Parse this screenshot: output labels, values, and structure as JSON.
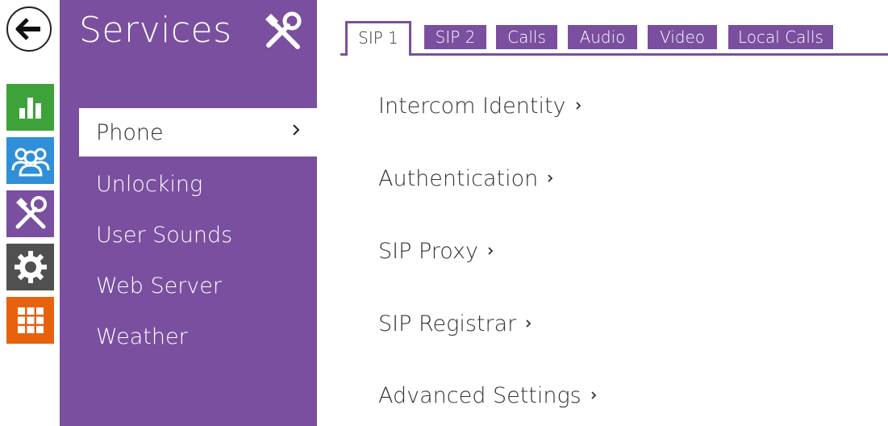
{
  "colors": {
    "accent": "#7a4f9f",
    "green": "#3ea23a",
    "blue": "#2f8fd8",
    "purple": "#7a4f9f",
    "gray": "#505050",
    "orange": "#e7620e"
  },
  "rail": {
    "back_icon": "arrow-left-icon",
    "tiles": [
      {
        "icon": "bar-chart-icon",
        "color": "#3ea23a"
      },
      {
        "icon": "users-icon",
        "color": "#2f8fd8"
      },
      {
        "icon": "tools-icon",
        "color": "#7a4f9f"
      },
      {
        "icon": "gear-icon",
        "color": "#505050"
      },
      {
        "icon": "grid-icon",
        "color": "#e7620e"
      }
    ]
  },
  "sidebar": {
    "title": "Services",
    "title_icon": "tools-icon",
    "items": [
      {
        "label": "Phone",
        "active": true
      },
      {
        "label": "Unlocking",
        "active": false
      },
      {
        "label": "User Sounds",
        "active": false
      },
      {
        "label": "Web Server",
        "active": false
      },
      {
        "label": "Weather",
        "active": false
      }
    ]
  },
  "tabs": [
    {
      "label": "SIP 1",
      "active": true
    },
    {
      "label": "SIP 2",
      "active": false
    },
    {
      "label": "Calls",
      "active": false
    },
    {
      "label": "Audio",
      "active": false
    },
    {
      "label": "Video",
      "active": false
    },
    {
      "label": "Local Calls",
      "active": false
    }
  ],
  "sections": [
    {
      "label": "Intercom Identity"
    },
    {
      "label": "Authentication"
    },
    {
      "label": "SIP Proxy"
    },
    {
      "label": "SIP Registrar"
    },
    {
      "label": "Advanced Settings"
    }
  ]
}
